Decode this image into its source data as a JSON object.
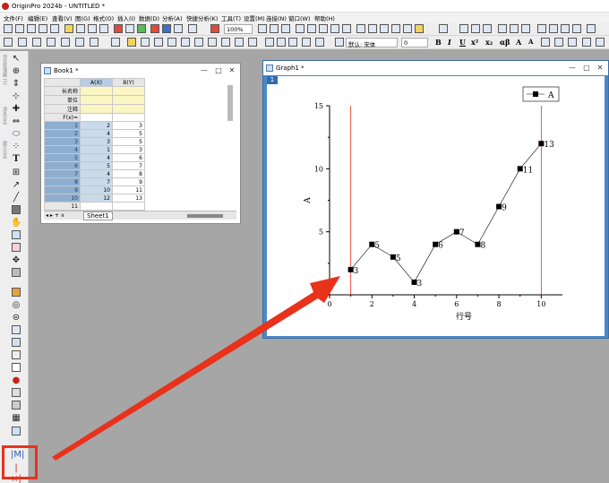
{
  "app": {
    "title": "OriginPro 2024b - UNTITLED *"
  },
  "menu": [
    "文件(F)",
    "编辑(E)",
    "查看(V)",
    "图(G)",
    "格式(O)",
    "插入(I)",
    "数据(D)",
    "分析(A)",
    "快捷分析(K)",
    "工具(T)",
    "设置(M)",
    "连接(N)",
    "窗口(W)",
    "帮助(H)"
  ],
  "toolbar": {
    "zoom": "100%",
    "font_name": "默认: 宋体",
    "font_size": "0",
    "bold": "B",
    "italic": "I",
    "underline": "U",
    "superscript": "x²",
    "subscript": "x₂",
    "greek": "αβ",
    "grow_font": "A",
    "shrink_font": "A"
  },
  "left_panel_tabs": [
    "项目管理器 (1)",
    "消息日志",
    "提示日志"
  ],
  "workbook": {
    "title": "Book1 *",
    "columns": [
      "A(X)",
      "B(Y)"
    ],
    "meta_rows": [
      "长名称",
      "单位",
      "注释",
      "F(x)="
    ],
    "rows": [
      [
        "1",
        "2",
        "3"
      ],
      [
        "2",
        "4",
        "5"
      ],
      [
        "3",
        "3",
        "5"
      ],
      [
        "4",
        "1",
        "3"
      ],
      [
        "5",
        "4",
        "6"
      ],
      [
        "6",
        "5",
        "7"
      ],
      [
        "7",
        "4",
        "8"
      ],
      [
        "8",
        "7",
        "9"
      ],
      [
        "9",
        "10",
        "11"
      ],
      [
        "10",
        "12",
        "13"
      ],
      [
        "11",
        "",
        ""
      ]
    ],
    "sheet_tab": "Sheet1"
  },
  "graph": {
    "title": "Graph1 *",
    "layer_label": "1"
  },
  "chart_data": {
    "type": "line",
    "x": [
      1,
      2,
      3,
      4,
      5,
      6,
      7,
      8,
      9,
      10
    ],
    "series": [
      {
        "name": "A",
        "values": [
          2,
          4,
          3,
          1,
          4,
          5,
          4,
          7,
          10,
          12
        ],
        "labels": [
          "3",
          "5",
          "5",
          "3",
          "6",
          "7",
          "8",
          "9",
          "11",
          "13"
        ]
      }
    ],
    "xlabel": "行号",
    "ylabel": "A",
    "xlim": [
      0,
      11
    ],
    "ylim": [
      0,
      15
    ],
    "xticks": [
      0,
      2,
      4,
      6,
      8,
      10
    ],
    "yticks": [
      0,
      5,
      10,
      15
    ],
    "vlines": [
      1,
      10
    ],
    "legend_position": "top-right",
    "grid": false,
    "colors": {
      "series": "#000000",
      "vline": "#e8321b"
    }
  },
  "annotation": {
    "arrow_color": "#e8321b",
    "highlight_color": "#e8321b"
  }
}
